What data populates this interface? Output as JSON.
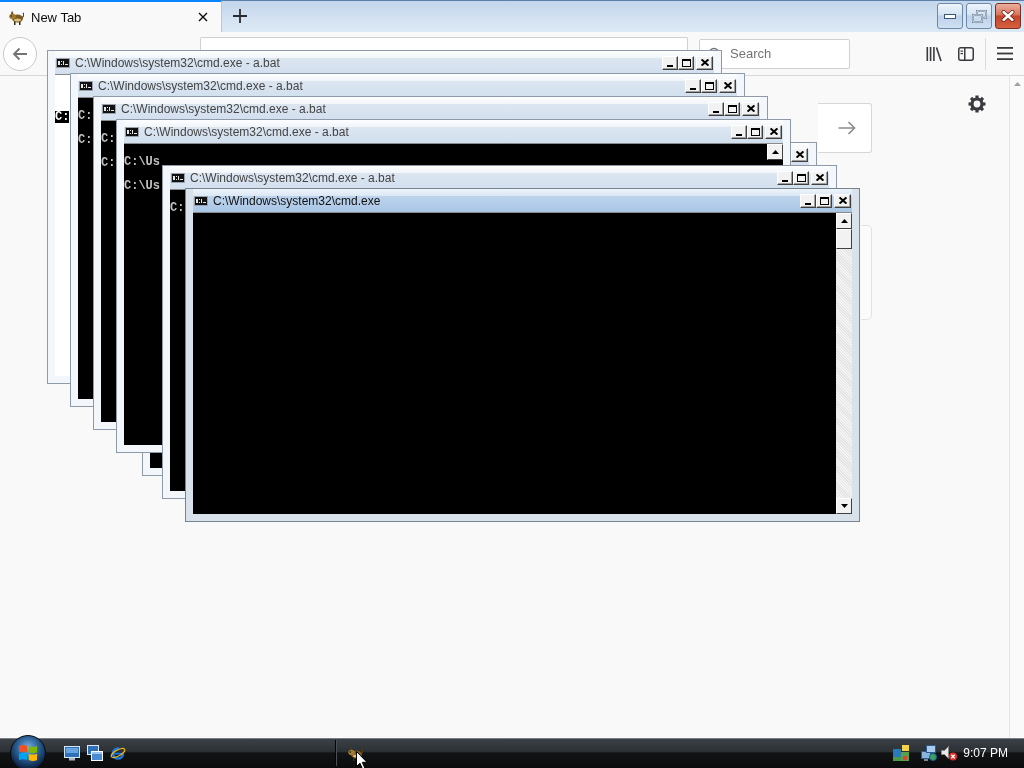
{
  "browser": {
    "tabs": [
      {
        "title": "New Tab",
        "selected": true
      }
    ],
    "search": {
      "placeholder": "Search"
    }
  },
  "console_windows": [
    {
      "title": "C:\\Windows\\system32\\cmd.exe - a.bat",
      "active": false,
      "kind": "unpainted",
      "controls": [
        {
          "kind": "minimize"
        },
        {
          "kind": "maximize"
        },
        {
          "kind": "close"
        }
      ],
      "lines": [
        {
          "text": "C:",
          "selected": true
        }
      ]
    },
    {
      "title": "C:\\Windows\\system32\\cmd.exe - a.bat",
      "active": false,
      "kind": "console",
      "controls": [
        {
          "kind": "minimize"
        },
        {
          "kind": "maximize"
        },
        {
          "kind": "close"
        }
      ],
      "lines": [
        {
          "text": "C:",
          "selected": false
        },
        {
          "text": "C:",
          "selected": false
        }
      ]
    },
    {
      "title": "C:\\Windows\\system32\\cmd.exe - a.bat",
      "active": false,
      "kind": "console",
      "controls": [
        {
          "kind": "minimize"
        },
        {
          "kind": "maximize"
        },
        {
          "kind": "close"
        }
      ],
      "lines": [
        {
          "text": "C:",
          "selected": false
        },
        {
          "text": "C:",
          "selected": false
        }
      ]
    },
    {
      "title": "C:\\Windows\\system32\\cmd.exe - a.bat",
      "active": false,
      "kind": "console",
      "scrollbar": {
        "kind": "arrow"
      },
      "controls": [
        {
          "kind": "minimize"
        },
        {
          "kind": "maximize"
        },
        {
          "kind": "close"
        }
      ],
      "lines": [
        {
          "text": "C:\\Us",
          "selected": false
        },
        {
          "text": "C:\\Us",
          "selected": false
        }
      ]
    },
    {
      "kind": "console",
      "controls": [
        {
          "kind": "close"
        }
      ]
    },
    {
      "title": "C:\\Windows\\system32\\cmd.exe - a.bat",
      "active": false,
      "kind": "console",
      "controls": [
        {
          "kind": "minimize"
        },
        {
          "kind": "maximize"
        },
        {
          "kind": "close"
        }
      ],
      "lines": [
        {
          "text": "C:",
          "selected": false
        }
      ]
    },
    {
      "title": "C:\\Windows\\system32\\cmd.exe",
      "active": true,
      "kind": "console",
      "scrollbar": {
        "kind": "full"
      },
      "controls": [
        {
          "kind": "minimize"
        },
        {
          "kind": "maximize"
        },
        {
          "kind": "close"
        }
      ]
    }
  ],
  "taskbar": {
    "clock": "9:07 PM"
  }
}
